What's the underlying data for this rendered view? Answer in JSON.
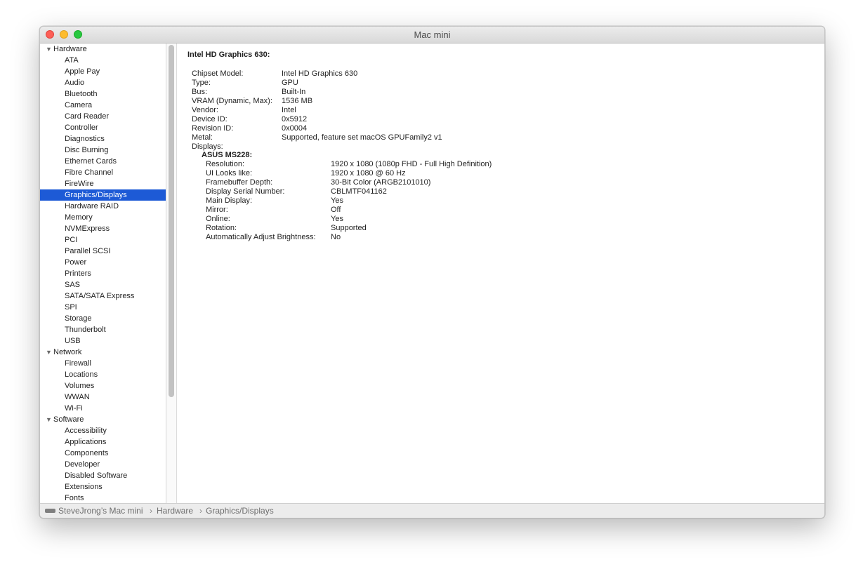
{
  "window": {
    "title": "Mac mini"
  },
  "sidebar": {
    "groups": [
      {
        "label": "Hardware",
        "items": [
          "ATA",
          "Apple Pay",
          "Audio",
          "Bluetooth",
          "Camera",
          "Card Reader",
          "Controller",
          "Diagnostics",
          "Disc Burning",
          "Ethernet Cards",
          "Fibre Channel",
          "FireWire",
          "Graphics/Displays",
          "Hardware RAID",
          "Memory",
          "NVMExpress",
          "PCI",
          "Parallel SCSI",
          "Power",
          "Printers",
          "SAS",
          "SATA/SATA Express",
          "SPI",
          "Storage",
          "Thunderbolt",
          "USB"
        ]
      },
      {
        "label": "Network",
        "items": [
          "Firewall",
          "Locations",
          "Volumes",
          "WWAN",
          "Wi-Fi"
        ]
      },
      {
        "label": "Software",
        "items": [
          "Accessibility",
          "Applications",
          "Components",
          "Developer",
          "Disabled Software",
          "Extensions",
          "Fonts"
        ]
      }
    ],
    "selected": "Graphics/Displays"
  },
  "detail": {
    "heading": "Intel HD Graphics 630:",
    "rows": [
      {
        "key": "Chipset Model:",
        "value": "Intel HD Graphics 630"
      },
      {
        "key": "Type:",
        "value": "GPU"
      },
      {
        "key": "Bus:",
        "value": "Built-In"
      },
      {
        "key": "VRAM (Dynamic, Max):",
        "value": "1536 MB"
      },
      {
        "key": "Vendor:",
        "value": "Intel"
      },
      {
        "key": "Device ID:",
        "value": "0x5912"
      },
      {
        "key": "Revision ID:",
        "value": "0x0004"
      },
      {
        "key": "Metal:",
        "value": "Supported, feature set macOS GPUFamily2 v1"
      },
      {
        "key": "Displays:",
        "value": ""
      }
    ],
    "display": {
      "name": "ASUS MS228:",
      "rows": [
        {
          "key": "Resolution:",
          "value": "1920 x 1080 (1080p FHD - Full High Definition)"
        },
        {
          "key": "UI Looks like:",
          "value": "1920 x 1080 @ 60 Hz"
        },
        {
          "key": "Framebuffer Depth:",
          "value": "30-Bit Color (ARGB2101010)"
        },
        {
          "key": "Display Serial Number:",
          "value": "CBLMTF041162"
        },
        {
          "key": "Main Display:",
          "value": "Yes"
        },
        {
          "key": "Mirror:",
          "value": "Off"
        },
        {
          "key": "Online:",
          "value": "Yes"
        },
        {
          "key": "Rotation:",
          "value": "Supported"
        },
        {
          "key": "Automatically Adjust Brightness:",
          "value": "No"
        }
      ]
    }
  },
  "statusbar": {
    "crumbs": [
      "SteveJrong’s Mac mini",
      "Hardware",
      "Graphics/Displays"
    ],
    "separator": "›"
  }
}
